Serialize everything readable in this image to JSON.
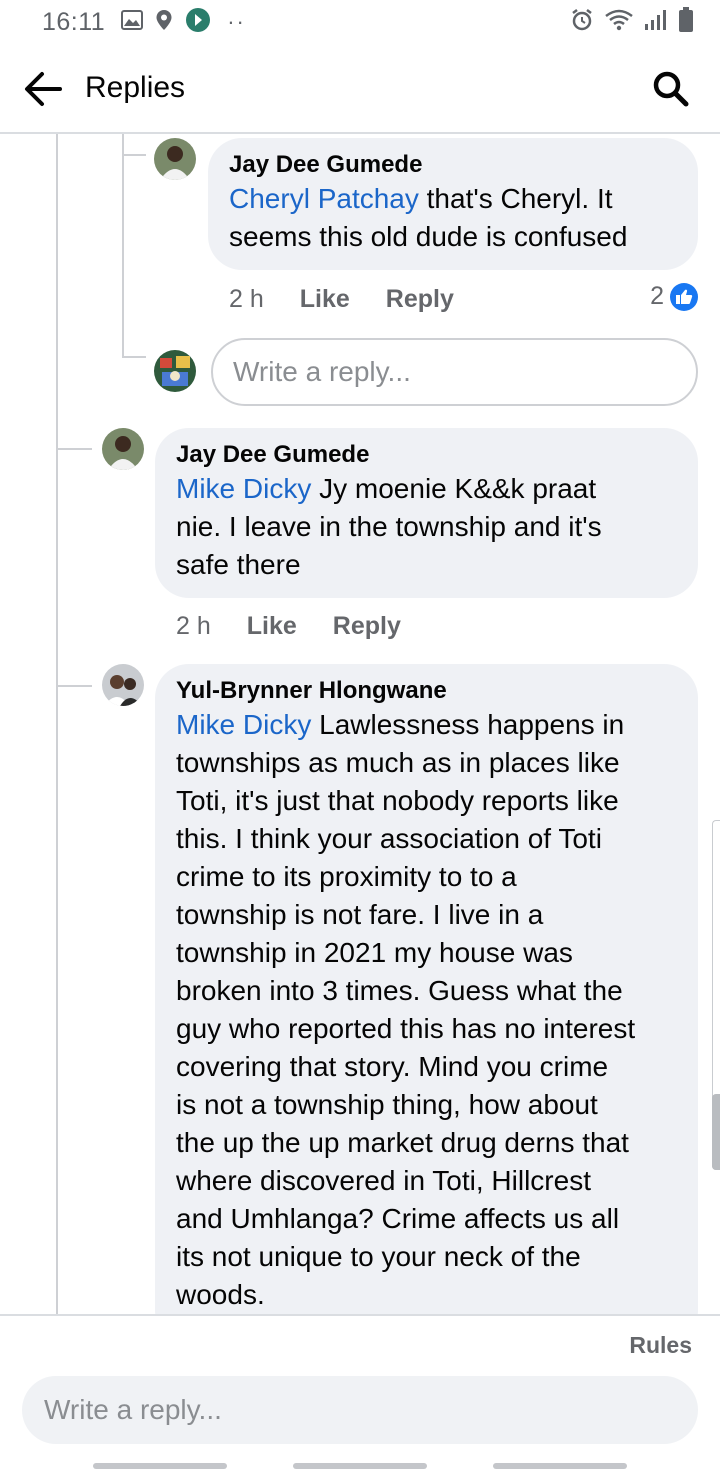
{
  "status_bar": {
    "time": "16:11"
  },
  "header": {
    "title": "Replies"
  },
  "comments": [
    {
      "author": "Jay Dee Gumede",
      "mention": "Cheryl Patchay",
      "text_lines": [
        " that's Cheryl. It",
        "seems this old  dude is confused"
      ],
      "time": "2 h",
      "like_label": "Like",
      "reply_label": "Reply",
      "reaction_count": "2"
    },
    {
      "author": "Jay Dee Gumede",
      "mention": "Mike Dicky",
      "text_lines": "  Jy moenie K&&k praat|nie. I leave in the township and it's|safe there",
      "time": "2 h",
      "like_label": "Like",
      "reply_label": "Reply"
    },
    {
      "author": "Yul-Brynner Hlongwane",
      "mention": "Mike Dicky",
      "text_lines": " Lawlessness happens in|townships as much as in places like|Toti, it's just that nobody reports like|this. I think your association of Toti|crime to its proximity to to a|township is not fare. I live in a|township in 2021 my house was|broken into 3 times. Guess what the|guy who reported this has no interest|covering that story. Mind you crime|is not a township thing, how about|the up the up market drug derns that|where discovered in Toti, Hillcrest|and Umhlanga? Crime affects us all|its not unique to your neck of the|woods."
    }
  ],
  "inline_reply": {
    "placeholder": "Write a reply..."
  },
  "footer": {
    "rules": "Rules",
    "placeholder": "Write a reply..."
  },
  "colors": {
    "mention": "#1b66c9",
    "like": "#1877f2",
    "bubble": "#eff1f5"
  },
  "icons": [
    "back-arrow-icon",
    "search-icon",
    "gallery-icon",
    "location-icon",
    "app-icon",
    "alarm-icon",
    "wifi-icon",
    "signal-icon",
    "battery-icon",
    "like-icon"
  ]
}
